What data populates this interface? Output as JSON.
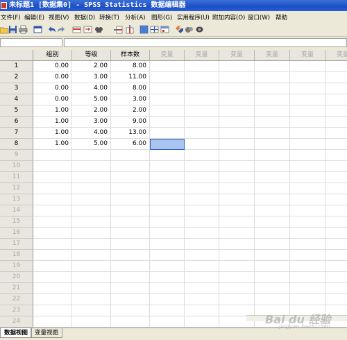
{
  "window": {
    "title": "未标题1 [数据集0] - SPSS Statistics 数据编辑器"
  },
  "menu": [
    {
      "label": "文件(F)"
    },
    {
      "label": "编辑(E)"
    },
    {
      "label": "视图(V)"
    },
    {
      "label": "数据(D)"
    },
    {
      "label": "转换(T)"
    },
    {
      "label": "分析(A)"
    },
    {
      "label": "图形(G)"
    },
    {
      "label": "实用程序(U)"
    },
    {
      "label": "附加内容(O)"
    },
    {
      "label": "窗口(W)"
    },
    {
      "label": "帮助"
    }
  ],
  "toolbar": {
    "icons": [
      "open-icon",
      "save-icon",
      "print-icon",
      "dialog-recall-icon",
      "undo-icon",
      "redo-icon",
      "goto-case-icon",
      "goto-variable-icon",
      "variables-icon",
      "insert-case-icon",
      "insert-variable-icon",
      "split-file-icon",
      "weight-cases-icon",
      "select-cases-icon",
      "value-labels-icon",
      "use-sets-icon",
      "show-sets-icon"
    ]
  },
  "cell_editor": {
    "reference": ":",
    "value": ""
  },
  "grid": {
    "columns": [
      {
        "label": "组别",
        "is_variable": true
      },
      {
        "label": "等级",
        "is_variable": true
      },
      {
        "label": "样本数",
        "is_variable": true
      },
      {
        "label": "变量",
        "is_variable": false
      },
      {
        "label": "变量",
        "is_variable": false
      },
      {
        "label": "变量",
        "is_variable": false
      },
      {
        "label": "变量",
        "is_variable": false
      },
      {
        "label": "变量",
        "is_variable": false
      },
      {
        "label": "变量",
        "is_variable": false
      }
    ],
    "row_numbers": [
      "1",
      "2",
      "3",
      "4",
      "5",
      "6",
      "7",
      "8",
      "9",
      "10",
      "11",
      "12",
      "13",
      "14",
      "15",
      "16",
      "17",
      "18",
      "19",
      "20",
      "21",
      "22",
      "23",
      "24"
    ],
    "rows": [
      [
        "0.00",
        "2.00",
        "8.00"
      ],
      [
        "0.00",
        "3.00",
        "11.00"
      ],
      [
        "0.00",
        "4.00",
        "8.00"
      ],
      [
        "0.00",
        "5.00",
        "3.00"
      ],
      [
        "1.00",
        "2.00",
        "2.00"
      ],
      [
        "1.00",
        "3.00",
        "9.00"
      ],
      [
        "1.00",
        "4.00",
        "13.00"
      ],
      [
        "1.00",
        "5.00",
        "6.00"
      ]
    ],
    "selected_cell": {
      "row": 8,
      "col": 4
    }
  },
  "tabs": [
    {
      "label": "数据视图",
      "active": true
    },
    {
      "label": "变量视图",
      "active": false
    }
  ],
  "watermark": {
    "brand": "Bai du 经验",
    "url": "jingyan.baidu.com"
  }
}
